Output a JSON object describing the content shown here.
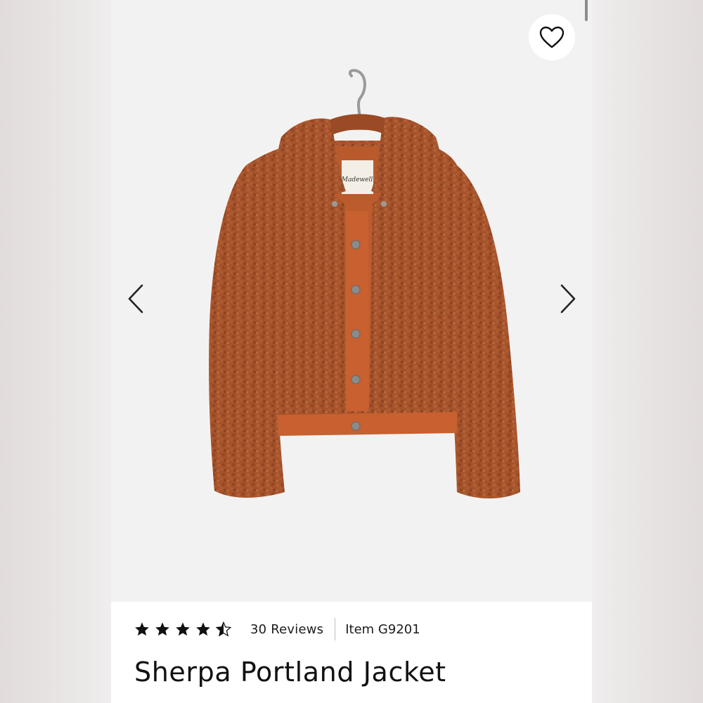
{
  "product": {
    "title": "Sherpa Portland Jacket",
    "item_code": "Item G9201",
    "reviews_label": "30 Reviews",
    "rating": 4.5,
    "rating_max": 5,
    "label_brand": "Madewell"
  },
  "icons": {
    "favorite": "heart-icon",
    "previous": "chevron-left-icon",
    "next": "chevron-right-icon",
    "star": "star-icon"
  },
  "colors": {
    "jacket": "#a4522b",
    "trim": "#c8602f",
    "panel": "#ffffff",
    "background": "#f3f2f2"
  }
}
